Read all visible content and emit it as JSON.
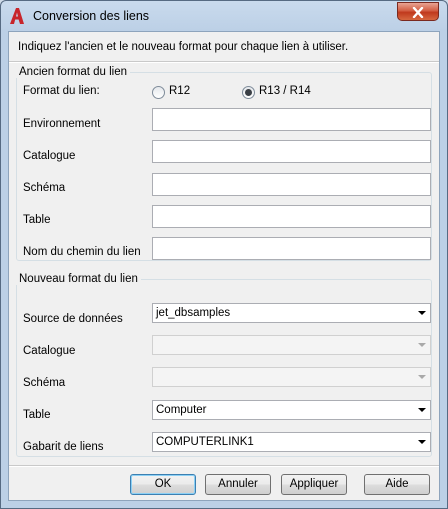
{
  "window": {
    "title": "Conversion des liens"
  },
  "instruction": "Indiquez l'ancien et le nouveau format pour chaque lien à utiliser.",
  "old_format": {
    "group_title": "Ancien format du lien",
    "format_label": "Format du lien:",
    "radio_r12": "R12",
    "radio_r13": "R13 / R14",
    "selected": "R13 / R14",
    "environment_label": "Environnement",
    "catalog_label": "Catalogue",
    "schema_label": "Schéma",
    "table_label": "Table",
    "path_label": "Nom du chemin du lien",
    "environment_value": "",
    "catalog_value": "",
    "schema_value": "",
    "table_value": "",
    "path_value": ""
  },
  "new_format": {
    "group_title": "Nouveau format du lien",
    "datasource_label": "Source de données",
    "datasource_value": "jet_dbsamples",
    "catalog_label": "Catalogue",
    "catalog_value": "",
    "schema_label": "Schéma",
    "schema_value": "",
    "table_label": "Table",
    "table_value": "Computer",
    "template_label": "Gabarit de liens",
    "template_value": "COMPUTERLINK1"
  },
  "buttons": {
    "ok": "OK",
    "cancel": "Annuler",
    "apply": "Appliquer",
    "help": "Aide"
  },
  "colors": {
    "app_icon": "#c8252b",
    "close_button": "#c0391d"
  }
}
